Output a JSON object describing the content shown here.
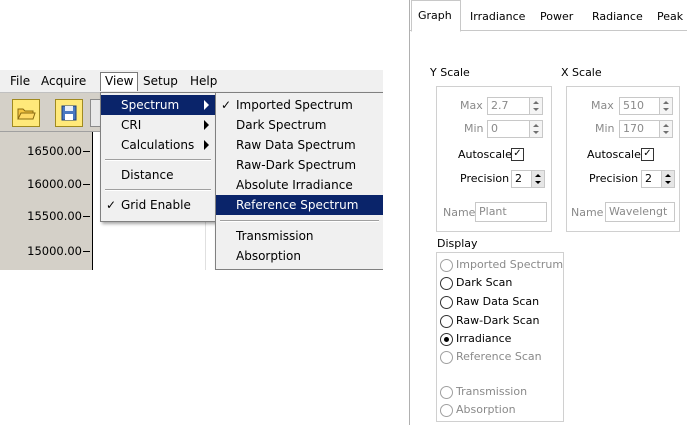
{
  "menubar": {
    "items": [
      "File",
      "Acquire",
      "View",
      "Setup",
      "Help"
    ]
  },
  "view_menu": {
    "items": [
      {
        "label": "Spectrum",
        "submenu": true,
        "selected": true
      },
      {
        "label": "CRI",
        "submenu": true
      },
      {
        "label": "Calculations",
        "submenu": true
      },
      {
        "label": "Distance"
      },
      {
        "label": "Grid Enable",
        "checked": true
      }
    ]
  },
  "spectrum_submenu": {
    "items": [
      {
        "label": "Imported Spectrum",
        "checked": true
      },
      {
        "label": "Dark Spectrum"
      },
      {
        "label": "Raw Data Spectrum"
      },
      {
        "label": "Raw-Dark Spectrum"
      },
      {
        "label": "Absolute Irradiance"
      },
      {
        "label": "Reference Spectrum",
        "selected": true
      },
      {
        "label": "Transmission"
      },
      {
        "label": "Absorption"
      }
    ]
  },
  "plot": {
    "y_ticks": [
      "16500.00",
      "16000.00",
      "15500.00",
      "15000.00"
    ]
  },
  "toolbar": {
    "icons": [
      "open-folder-icon",
      "save-icon"
    ]
  },
  "tabs": [
    "Graph",
    "Irradiance",
    "Power",
    "Radiance",
    "Peak"
  ],
  "y_scale": {
    "title": "Y Scale",
    "max_label": "Max",
    "max_value": "2.7",
    "min_label": "Min",
    "min_value": "0",
    "autoscale_label": "Autoscale",
    "precision_label": "Precision",
    "precision_value": "2",
    "name_label": "Name",
    "name_value": "Plant"
  },
  "x_scale": {
    "title": "X Scale",
    "max_label": "Max",
    "max_value": "510",
    "min_label": "Min",
    "min_value": "170",
    "autoscale_label": "Autoscale",
    "precision_label": "Precision",
    "precision_value": "2",
    "name_label": "Name",
    "name_value": "Wavelengt"
  },
  "display": {
    "title": "Display",
    "options": [
      {
        "label": "Imported Spectrum",
        "enabled": false,
        "checked": false
      },
      {
        "label": "Dark Scan",
        "enabled": true,
        "checked": false
      },
      {
        "label": "Raw Data Scan",
        "enabled": true,
        "checked": false
      },
      {
        "label": "Raw-Dark Scan",
        "enabled": true,
        "checked": false
      },
      {
        "label": "Irradiance",
        "enabled": true,
        "checked": true
      },
      {
        "label": "Reference Scan",
        "enabled": false,
        "checked": false
      },
      {
        "label": "Transmission",
        "enabled": false,
        "checked": false
      },
      {
        "label": "Absorption",
        "enabled": false,
        "checked": false
      }
    ]
  },
  "check_mark": "✓",
  "colors": {
    "menu_highlight": "#0a246a",
    "toolbar_button": "#ffe97a",
    "disabled_text": "#8a8a8a"
  }
}
